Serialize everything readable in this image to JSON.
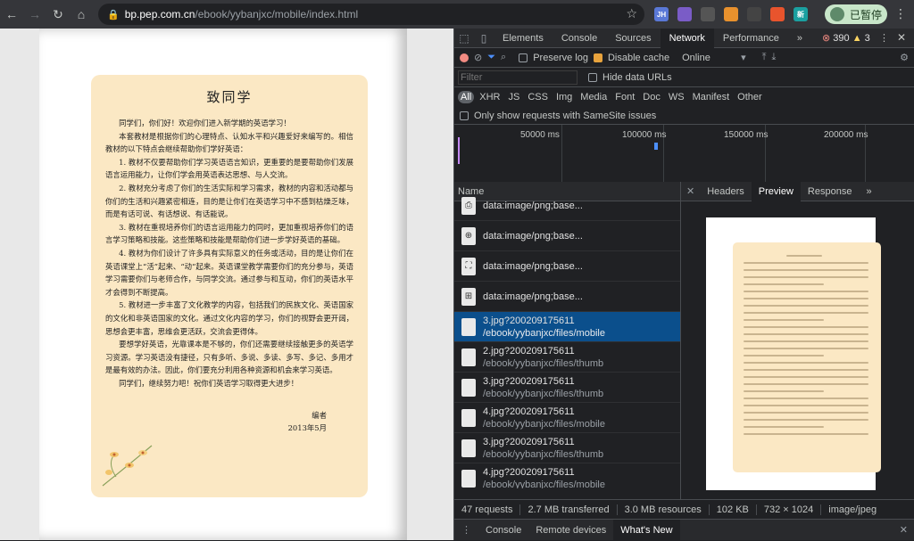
{
  "browser": {
    "url_host": "bp.pep.com.cn",
    "url_path": "/ebook/yybanjxc/mobile/index.html",
    "profile_label": "已暂停",
    "extensions": [
      {
        "label": "JH",
        "color": "#5a78d6"
      },
      {
        "label": "",
        "color": "#7a5cc7"
      },
      {
        "label": "",
        "color": "#555"
      },
      {
        "label": "",
        "color": "#e8912d"
      },
      {
        "label": "",
        "color": "#444"
      },
      {
        "label": "",
        "color": "#e8542d"
      },
      {
        "label": "新",
        "color": "#1ba0a0"
      }
    ]
  },
  "book": {
    "title": "致同学",
    "paragraphs": [
      "同学们，你们好！欢迎你们进入新学期的英语学习！",
      "本套教材是根据你们的心理特点、认知水平和兴趣爱好来编写的。相信教材的以下特点会继续帮助你们学好英语：",
      "1. 教材不仅要帮助你们学习英语语言知识，更重要的是要帮助你们发展语言运用能力，让你们学会用英语表达思想、与人交流。",
      "2. 教材充分考虑了你们的生活实际和学习需求，教材的内容和活动都与你们的生活和兴趣紧密相连，目的是让你们在英语学习中不感到枯燥乏味，而是有话可说、有话想说、有话能说。",
      "3. 教材在重视培养你们的语言运用能力的同时，更加重视培养你们的语言学习策略和技能。这些策略和技能是帮助你们进一步学好英语的基础。",
      "4. 教材为你们设计了许多具有实际意义的任务或活动，目的是让你们在英语课堂上“活”起来、“动”起来。英语课堂教学需要你们的充分参与，英语学习需要你们与老师合作，与同学交流。通过参与和互动，你们的英语水平才会得到不断提高。",
      "5. 教材进一步丰富了文化教学的内容，包括我们的民族文化、英语国家的文化和非英语国家的文化。通过文化内容的学习，你们的视野会更开阔，思想会更丰富，思维会更活跃，交流会更得体。",
      "要想学好英语，光靠课本是不够的，你们还需要继续接触更多的英语学习资源。学习英语没有捷径，只有多听、多说、多读、多写、多记、多用才是最有效的办法。因此，你们要充分利用各种资源和机会来学习英语。",
      "同学们，继续努力吧！祝你们英语学习取得更大进步！"
    ],
    "signature": "编者",
    "date": "2013年5月"
  },
  "devtools": {
    "tabs": [
      "Elements",
      "Console",
      "Sources",
      "Network",
      "Performance",
      "»"
    ],
    "active_tab": "Network",
    "error_count": "390",
    "warning_count": "3",
    "toolbar": {
      "preserve_log": "Preserve log",
      "disable_cache": "Disable cache",
      "throttle": "Online"
    },
    "filter_placeholder": "Filter",
    "hide_data_urls": "Hide data URLs",
    "types": [
      "All",
      "XHR",
      "JS",
      "CSS",
      "Img",
      "Media",
      "Font",
      "Doc",
      "WS",
      "Manifest",
      "Other"
    ],
    "samesite": "Only show requests with SameSite issues",
    "overview_ticks": [
      "50000 ms",
      "100000 ms",
      "150000 ms",
      "200000 ms"
    ],
    "name_header": "Name",
    "requests": [
      {
        "name": "data:image/png;base...",
        "sub": "",
        "icon": "print-icon",
        "glyph": "⎙"
      },
      {
        "name": "data:image/png;base...",
        "sub": "",
        "icon": "zoom-icon",
        "glyph": "⊕"
      },
      {
        "name": "data:image/png;base...",
        "sub": "",
        "icon": "fullscreen-icon",
        "glyph": "⛶"
      },
      {
        "name": "data:image/png;base...",
        "sub": "",
        "icon": "grid-icon",
        "glyph": "⊞"
      },
      {
        "name": "3.jpg?200209175611",
        "sub": "/ebook/yybanjxc/files/mobile",
        "icon": "page-thumb-icon",
        "glyph": "",
        "selected": true
      },
      {
        "name": "2.jpg?200209175611",
        "sub": "/ebook/yybanjxc/files/thumb",
        "icon": "page-thumb-icon",
        "glyph": ""
      },
      {
        "name": "3.jpg?200209175611",
        "sub": "/ebook/yybanjxc/files/thumb",
        "icon": "page-thumb-icon",
        "glyph": ""
      },
      {
        "name": "4.jpg?200209175611",
        "sub": "/ebook/yybanjxc/files/mobile",
        "icon": "page-thumb-icon",
        "glyph": ""
      },
      {
        "name": "3.jpg?200209175611",
        "sub": "/ebook/yybanjxc/files/thumb",
        "icon": "page-thumb-icon",
        "glyph": ""
      },
      {
        "name": "4.jpg?200209175611",
        "sub": "/ebook/yybanjxc/files/mobile",
        "icon": "page-thumb-icon",
        "glyph": ""
      }
    ],
    "preview_tabs": [
      "Headers",
      "Preview",
      "Response",
      "»"
    ],
    "active_preview_tab": "Preview",
    "status": {
      "requests": "47 requests",
      "transferred": "2.7 MB transferred",
      "resources": "3.0 MB resources",
      "size": "102 KB",
      "dims": "732 × 1024",
      "mime": "image/jpeg"
    },
    "drawer_tabs": [
      "Console",
      "Remote devices",
      "What's New"
    ],
    "active_drawer_tab": "What's New"
  }
}
